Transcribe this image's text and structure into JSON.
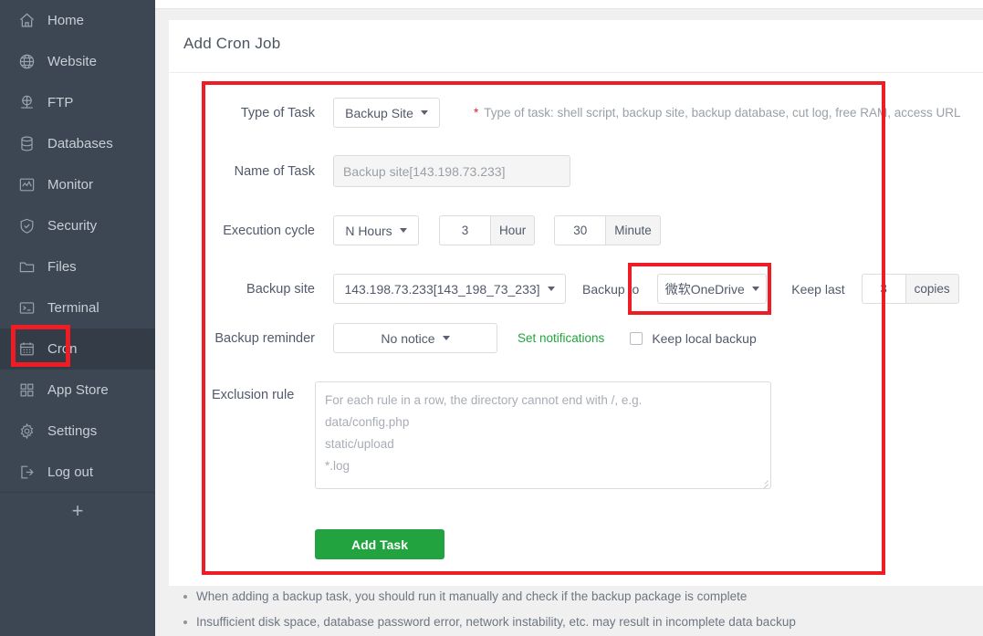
{
  "sidebar": {
    "items": [
      {
        "label": "Home",
        "icon": "home-icon",
        "active": false
      },
      {
        "label": "Website",
        "icon": "globe-icon",
        "active": false
      },
      {
        "label": "FTP",
        "icon": "ftp-icon",
        "active": false
      },
      {
        "label": "Databases",
        "icon": "database-icon",
        "active": false
      },
      {
        "label": "Monitor",
        "icon": "monitor-icon",
        "active": false
      },
      {
        "label": "Security",
        "icon": "shield-icon",
        "active": false
      },
      {
        "label": "Files",
        "icon": "folder-icon",
        "active": false
      },
      {
        "label": "Terminal",
        "icon": "terminal-icon",
        "active": false
      },
      {
        "label": "Cron",
        "icon": "calendar-icon",
        "active": true
      },
      {
        "label": "App Store",
        "icon": "grid-icon",
        "active": false
      },
      {
        "label": "Settings",
        "icon": "gear-icon",
        "active": false
      },
      {
        "label": "Log out",
        "icon": "logout-icon",
        "active": false
      }
    ],
    "add_button": "+"
  },
  "card": {
    "title": "Add Cron Job"
  },
  "form": {
    "type_of_task": {
      "label": "Type of Task",
      "value": "Backup Site",
      "hint_star": "*",
      "hint": "Type of task: shell script, backup site, backup database, cut log, free RAM, access URL"
    },
    "name_of_task": {
      "label": "Name of Task",
      "value": "Backup site[143.198.73.233]"
    },
    "execution_cycle": {
      "label": "Execution cycle",
      "value": "N Hours",
      "hour_value": "3",
      "hour_suffix": "Hour",
      "minute_value": "30",
      "minute_suffix": "Minute"
    },
    "backup_site": {
      "label": "Backup site",
      "value": "143.198.73.233[143_198_73_233]"
    },
    "backup_to": {
      "label": "Backup to",
      "value": "微软OneDrive"
    },
    "keep_last": {
      "label": "Keep last",
      "value": "3",
      "suffix": "copies"
    },
    "backup_reminder": {
      "label": "Backup reminder",
      "value": "No notice",
      "set_notifications_link": "Set notifications",
      "keep_local_backup_label": "Keep local backup",
      "keep_local_backup_checked": false
    },
    "exclusion_rule": {
      "label": "Exclusion rule",
      "placeholder_lines": [
        "For each rule in a row, the directory cannot end with /, e.g.",
        "data/config.php",
        "static/upload",
        " *.log"
      ]
    },
    "submit": {
      "label": "Add Task"
    }
  },
  "notes": [
    "When adding a backup task, you should run it manually and check if the backup package is complete",
    "Insufficient disk space, database password error, network instability, etc. may result in incomplete data backup"
  ],
  "colors": {
    "sidebar_bg": "#3d4753",
    "sidebar_active_bg": "#333c47",
    "accent_green": "#22a33f",
    "annotation_red": "#ee1c25",
    "link_green": "#20a53a"
  }
}
